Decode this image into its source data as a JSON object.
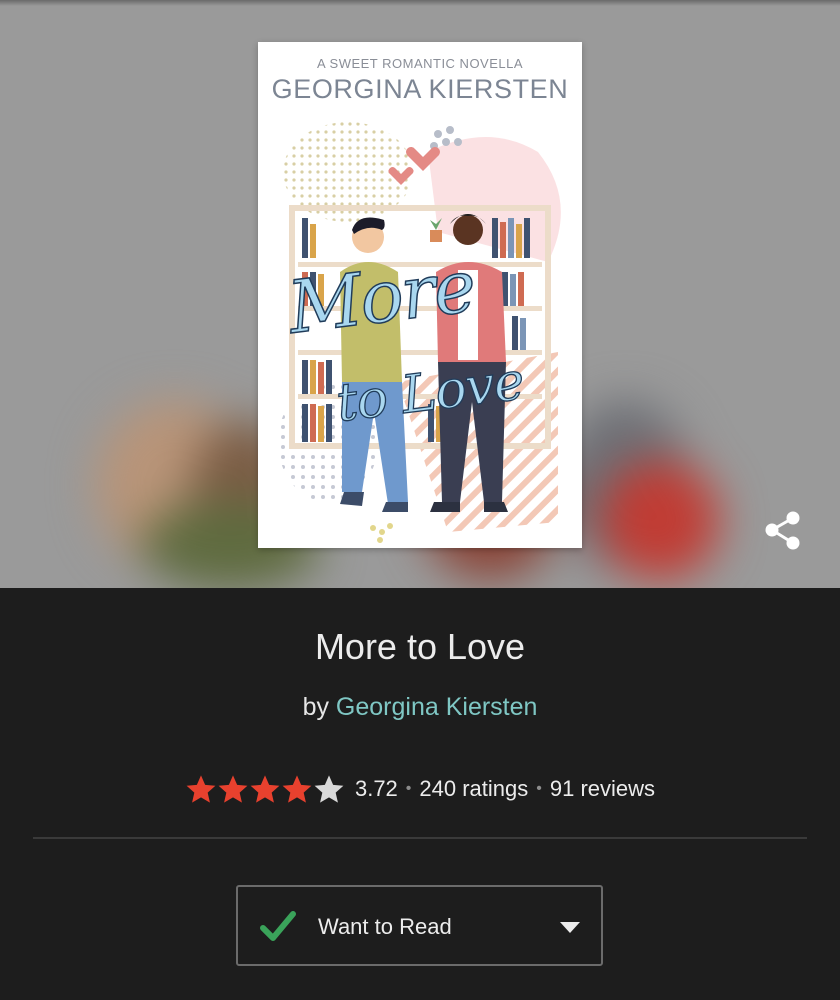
{
  "cover": {
    "series_line": "A SWEET ROMANTIC NOVELLA",
    "author_line": "GEORGINA KIERSTEN",
    "title_line_1": "More",
    "title_line_2": "to Love"
  },
  "book": {
    "title": "More to Love",
    "by_label": "by",
    "author": "Georgina Kiersten"
  },
  "rating": {
    "average": "3.72",
    "stars_filled": 4,
    "stars_total": 5,
    "ratings_text": "240 ratings",
    "reviews_text": "91 reviews"
  },
  "shelf_button": {
    "label": "Want to Read"
  },
  "colors": {
    "star_filled": "#e8412e",
    "star_empty": "#d9d9d9",
    "author_link": "#7fc7c4",
    "check": "#3aa35a"
  },
  "icons": {
    "share": "share-icon",
    "check": "check-icon",
    "dropdown": "chevron-down-icon"
  }
}
